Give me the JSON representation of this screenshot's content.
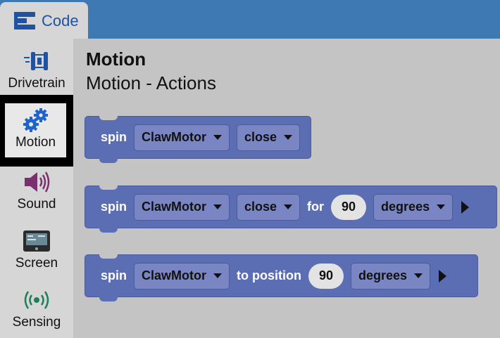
{
  "tab": {
    "label": "Code"
  },
  "sidebar": {
    "items": [
      {
        "label": "Drivetrain",
        "icon": "drivetrain-icon"
      },
      {
        "label": "Motion",
        "icon": "gears-icon"
      },
      {
        "label": "Sound",
        "icon": "speaker-icon"
      },
      {
        "label": "Screen",
        "icon": "screen-icon"
      },
      {
        "label": "Sensing",
        "icon": "signal-icon"
      }
    ]
  },
  "workspace": {
    "title": "Motion",
    "subtitle": "Motion - Actions"
  },
  "blocks": [
    {
      "spin": "spin",
      "motor": "ClawMotor",
      "dir": "close"
    },
    {
      "spin": "spin",
      "motor": "ClawMotor",
      "dir": "close",
      "for": "for",
      "value": "90",
      "unit": "degrees"
    },
    {
      "spin": "spin",
      "motor": "ClawMotor",
      "to_position": "to position",
      "value": "90",
      "unit": "degrees"
    }
  ],
  "colors": {
    "topbar": "#3f79b4",
    "block": "#5b6db3",
    "accent": "#1f53a1"
  }
}
